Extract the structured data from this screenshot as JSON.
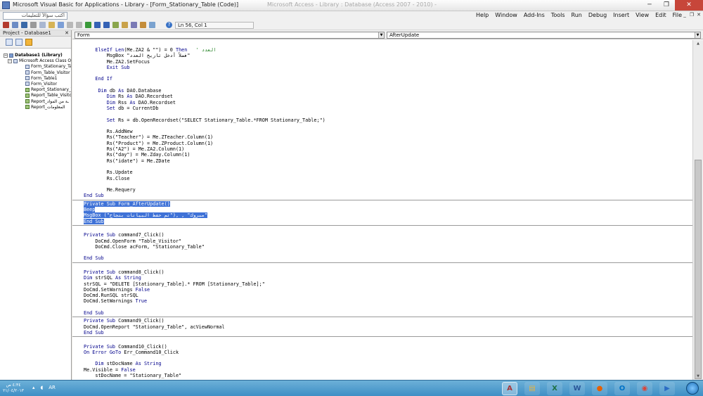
{
  "window": {
    "title": "Microsoft Visual Basic for Applications - Library - [Form_Stationary_Table (Code)]",
    "ghost_title": "Microsoft Access - Library : Database (Access 2007 - 2010) -"
  },
  "menubar": {
    "ask_placeholder": "اكتب سؤالاً للتعليمات",
    "items": [
      "Help",
      "Window",
      "Add-Ins",
      "Tools",
      "Run",
      "Debug",
      "Insert",
      "View",
      "Edit",
      "File"
    ]
  },
  "toolbar": {
    "position": "Ln 56, Col 1"
  },
  "project": {
    "title": "Project - Database1",
    "tree": [
      {
        "label": "Database1 (Library)",
        "level": 0,
        "icon": "project-icon"
      },
      {
        "label": "Microsoft Access Class Objects",
        "level": 1,
        "icon": "folder-icon"
      },
      {
        "label": "Form_Stationary_Table",
        "level": 2,
        "icon": "form-icon"
      },
      {
        "label": "Form_Table_Visitor",
        "level": 2,
        "icon": "form-icon"
      },
      {
        "label": "Form_Table1",
        "level": 2,
        "icon": "form-icon"
      },
      {
        "label": "Form_Visitor",
        "level": 2,
        "icon": "form-icon"
      },
      {
        "label": "Report_Stationary_Table",
        "level": 2,
        "icon": "report-icon"
      },
      {
        "label": "Report_Table_Visitor",
        "level": 2,
        "icon": "report-icon"
      },
      {
        "label": "Report_ـة من المواد",
        "level": 2,
        "icon": "report-icon"
      },
      {
        "label": "Report_المعلومات",
        "level": 2,
        "icon": "report-icon"
      }
    ]
  },
  "editor": {
    "object_combo": "Form",
    "procedure_combo": "AfterUpdate",
    "lines": [
      {
        "t": "    ElseIf Len(Me.ZA2 & \"\") = 0 Then   ' العدد",
        "kw": [
          "ElseIf",
          "Len",
          "Then"
        ]
      },
      {
        "t": "        MsgBox \"فضلاً أدخل تاريخ العدد\"",
        "kw": []
      },
      {
        "t": "        Me.ZA2.SetFocus",
        "kw": []
      },
      {
        "t": "        Exit Sub",
        "kw": [
          "Exit",
          "Sub"
        ]
      },
      {
        "t": "",
        "kw": []
      },
      {
        "t": "    End If",
        "kw": [
          "End",
          "If"
        ]
      },
      {
        "t": "",
        "kw": []
      },
      {
        "t": "     Dim db As DAO.Database",
        "kw": [
          "Dim",
          "As"
        ]
      },
      {
        "t": "        Dim Rs As DAO.Recordset",
        "kw": [
          "Dim",
          "As"
        ]
      },
      {
        "t": "        Dim Rss As DAO.Recordset",
        "kw": [
          "Dim",
          "As"
        ]
      },
      {
        "t": "        Set db = CurrentDb",
        "kw": [
          "Set"
        ]
      },
      {
        "t": "",
        "kw": []
      },
      {
        "t": "        Set Rs = db.OpenRecordset(\"SELECT Stationary_Table.*FROM Stationary_Table;\")",
        "kw": [
          "Set"
        ]
      },
      {
        "t": "",
        "kw": []
      },
      {
        "t": "        Rs.AddNew",
        "kw": []
      },
      {
        "t": "        Rs(\"Teacher\") = Me.ZTeacher.Column(1)",
        "kw": []
      },
      {
        "t": "        Rs(\"Product\") = Me.ZProduct.Column(1)",
        "kw": []
      },
      {
        "t": "        Rs(\"A2\") = Me.ZA2.Column(1)",
        "kw": []
      },
      {
        "t": "        Rs(\"day\") = Me.Zday.Column(1)",
        "kw": []
      },
      {
        "t": "        Rs(\"idate\") = Me.ZDate",
        "kw": []
      },
      {
        "t": "",
        "kw": []
      },
      {
        "t": "        Rs.Update",
        "kw": []
      },
      {
        "t": "        Rs.Close",
        "kw": []
      },
      {
        "t": "",
        "kw": []
      },
      {
        "t": "        Me.Requery",
        "kw": []
      },
      {
        "t": "End Sub",
        "kw": [
          "End",
          "Sub"
        ],
        "sep": true
      },
      {
        "t": "Private Sub Form_AfterUpdate()",
        "kw": [
          "Private",
          "Sub"
        ],
        "hl": true
      },
      {
        "t": "Beep",
        "kw": [
          "Beep"
        ],
        "hl": true
      },
      {
        "t": "MsgBox (\"تم حفظ البيانات بنجاح\"), , \"مبروك\"",
        "kw": [],
        "hl": true
      },
      {
        "t": "End Sub",
        "kw": [
          "End",
          "Sub"
        ],
        "hl": true,
        "sep": true
      },
      {
        "t": "",
        "kw": []
      },
      {
        "t": "Private Sub command7_Click()",
        "kw": [
          "Private",
          "Sub"
        ]
      },
      {
        "t": "    DoCmd.OpenForm \"Table_Visitor\"",
        "kw": []
      },
      {
        "t": "    DoCmd.Close acForm, \"Stationary_Table\"",
        "kw": []
      },
      {
        "t": "",
        "kw": []
      },
      {
        "t": "End Sub",
        "kw": [
          "End",
          "Sub"
        ],
        "sep": true
      },
      {
        "t": "",
        "kw": []
      },
      {
        "t": "Private Sub command8_Click()",
        "kw": [
          "Private",
          "Sub"
        ]
      },
      {
        "t": "Dim strSQL As String",
        "kw": [
          "Dim",
          "As",
          "String"
        ]
      },
      {
        "t": "strSQL = \"DELETE [Stationary_Table].* FROM [Stationary_Table];\"",
        "kw": []
      },
      {
        "t": "DoCmd.SetWarnings False",
        "kw": [
          "False"
        ]
      },
      {
        "t": "DoCmd.RunSQL strSQL",
        "kw": []
      },
      {
        "t": "DoCmd.SetWarnings True",
        "kw": [
          "True"
        ]
      },
      {
        "t": "",
        "kw": []
      },
      {
        "t": "End Sub",
        "kw": [
          "End",
          "Sub"
        ],
        "sep": true
      },
      {
        "t": "Private Sub Command9_Click()",
        "kw": [
          "Private",
          "Sub"
        ]
      },
      {
        "t": "DoCmd.OpenReport \"Stationary_Table\", acViewNormal",
        "kw": []
      },
      {
        "t": "End Sub",
        "kw": [
          "End",
          "Sub"
        ],
        "sep": true
      },
      {
        "t": "",
        "kw": []
      },
      {
        "t": "Private Sub Command10_Click()",
        "kw": [
          "Private",
          "Sub"
        ]
      },
      {
        "t": "On Error GoTo Err_Command10_Click",
        "kw": [
          "On",
          "Error",
          "GoTo"
        ]
      },
      {
        "t": "",
        "kw": []
      },
      {
        "t": "    Dim stDocName As String",
        "kw": [
          "Dim",
          "As",
          "String"
        ]
      },
      {
        "t": "Me.Visible = False",
        "kw": [
          "False"
        ]
      },
      {
        "t": "    stDocName = \"Stationary_Table\"",
        "kw": []
      }
    ]
  },
  "taskbar": {
    "clock_time": "٤:٣٤ ص",
    "clock_date": "٢١/٠٤/٢٠١٣",
    "lang": "AR",
    "apps": [
      {
        "name": "access-app",
        "glyph": "A",
        "color": "#a4373a",
        "active": true
      },
      {
        "name": "explorer-app",
        "glyph": "▤",
        "color": "#e6b341",
        "active": false
      },
      {
        "name": "excel-app",
        "glyph": "X",
        "color": "#1e7145",
        "active": false
      },
      {
        "name": "word-app",
        "glyph": "W",
        "color": "#2b579a",
        "active": false
      },
      {
        "name": "firefox-app",
        "glyph": "●",
        "color": "#e66000",
        "active": false
      },
      {
        "name": "outlook-app",
        "glyph": "O",
        "color": "#0072c6",
        "active": false
      },
      {
        "name": "chrome-app",
        "glyph": "◉",
        "color": "#db4437",
        "active": false
      },
      {
        "name": "media-player-app",
        "glyph": "▶",
        "color": "#2b6cc4",
        "active": false
      }
    ]
  }
}
